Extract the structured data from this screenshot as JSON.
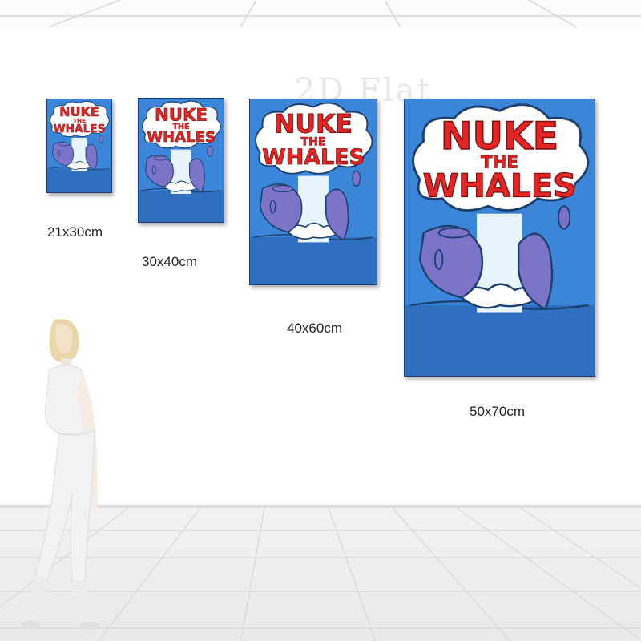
{
  "watermark": "2D Flat",
  "poster": {
    "line1": "NUKE",
    "line2": "THE",
    "line3": "WHALES",
    "colors": {
      "background": "#3b86d8",
      "sea": "#2f6fc0",
      "cloud": "#ffffff",
      "title": "#e22626",
      "whale": "#7b74c9"
    }
  },
  "sizes": [
    "21x30cm",
    "30x40cm",
    "40x60cm",
    "50x70cm"
  ]
}
